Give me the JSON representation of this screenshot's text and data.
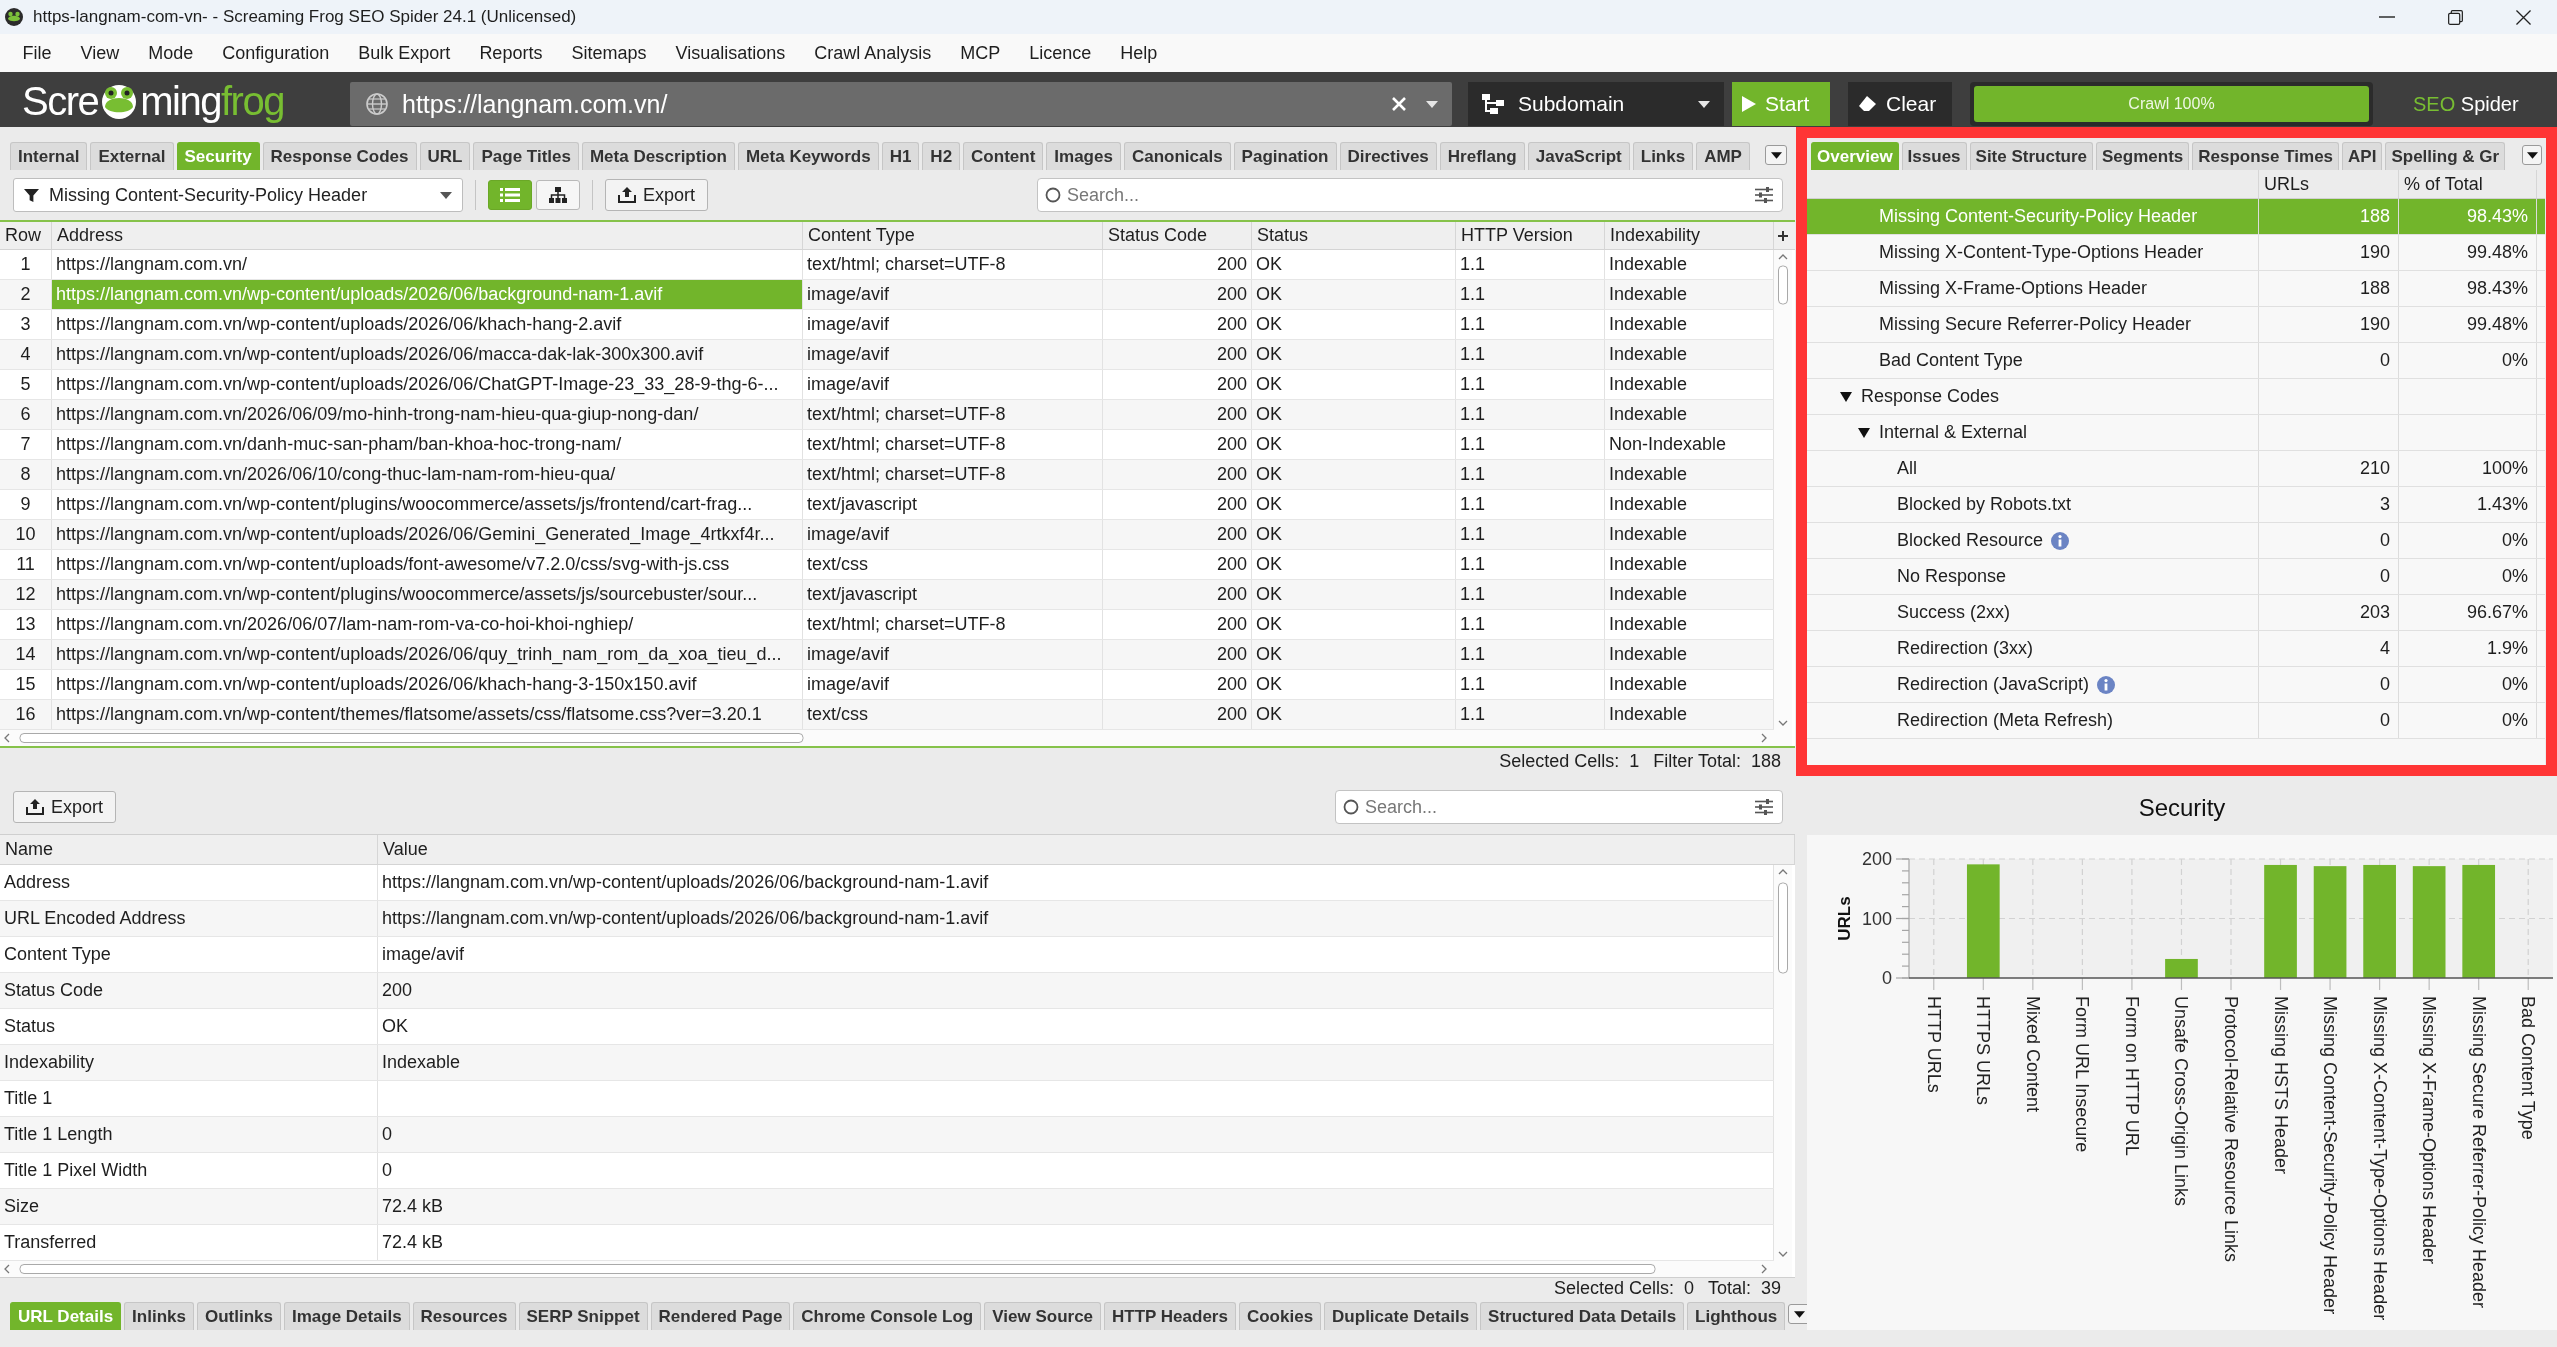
{
  "window": {
    "title": "https-langnam-com-vn- - Screaming Frog SEO Spider 24.1 (Unlicensed)"
  },
  "menu": [
    "File",
    "View",
    "Mode",
    "Configuration",
    "Bulk Export",
    "Reports",
    "Sitemaps",
    "Visualisations",
    "Crawl Analysis",
    "MCP",
    "Licence",
    "Help"
  ],
  "toolbar": {
    "logo": {
      "start": "Scre",
      "middle": "ming",
      "accent": "frog"
    },
    "url_field": {
      "value": "https://langnam.com.vn/"
    },
    "mode_dropdown": {
      "value": "Subdomain"
    },
    "start_button": "Start",
    "clear_button": "Clear",
    "crawl_progress": {
      "label": "Crawl 100%",
      "level": 1
    },
    "product_name": {
      "accent": "SEO",
      "text": "Spider"
    }
  },
  "main_tabs": [
    {
      "label": "Internal",
      "selected": false
    },
    {
      "label": "External",
      "selected": false
    },
    {
      "label": "Security",
      "selected": true
    },
    {
      "label": "Response Codes",
      "selected": false
    },
    {
      "label": "URL",
      "selected": false
    },
    {
      "label": "Page Titles",
      "selected": false
    },
    {
      "label": "Meta Description",
      "selected": false
    },
    {
      "label": "Meta Keywords",
      "selected": false
    },
    {
      "label": "H1",
      "selected": false
    },
    {
      "label": "H2",
      "selected": false
    },
    {
      "label": "Content",
      "selected": false
    },
    {
      "label": "Images",
      "selected": false
    },
    {
      "label": "Canonicals",
      "selected": false
    },
    {
      "label": "Pagination",
      "selected": false
    },
    {
      "label": "Directives",
      "selected": false
    },
    {
      "label": "Hreflang",
      "selected": false
    },
    {
      "label": "JavaScript",
      "selected": false
    },
    {
      "label": "Links",
      "selected": false
    },
    {
      "label": "AMP",
      "selected": false
    }
  ],
  "filter": {
    "dropdown": "Missing Content-Security-Policy Header",
    "views": [
      {
        "kind": "list",
        "selected": true
      },
      {
        "kind": "tree",
        "selected": false
      }
    ],
    "export_button": "Export",
    "search": {
      "placeholder": "Search..."
    }
  },
  "table": {
    "columns": [
      "Row",
      "Address",
      "Content Type",
      "Status Code",
      "Status",
      "HTTP Version",
      "Indexability"
    ],
    "rows": [
      {
        "cells": [
          "1",
          "https://langnam.com.vn/",
          "text/html; charset=UTF-8",
          "200",
          "OK",
          "1.1",
          "Indexable"
        ],
        "selected": false
      },
      {
        "cells": [
          "2",
          "https://langnam.com.vn/wp-content/uploads/2026/06/background-nam-1.avif",
          "image/avif",
          "200",
          "OK",
          "1.1",
          "Indexable"
        ],
        "selected": true
      },
      {
        "cells": [
          "3",
          "https://langnam.com.vn/wp-content/uploads/2026/06/khach-hang-2.avif",
          "image/avif",
          "200",
          "OK",
          "1.1",
          "Indexable"
        ],
        "selected": false
      },
      {
        "cells": [
          "4",
          "https://langnam.com.vn/wp-content/uploads/2026/06/macca-dak-lak-300x300.avif",
          "image/avif",
          "200",
          "OK",
          "1.1",
          "Indexable"
        ],
        "selected": false
      },
      {
        "cells": [
          "5",
          "https://langnam.com.vn/wp-content/uploads/2026/06/ChatGPT-Image-23_33_28-9-thg-6-...",
          "image/avif",
          "200",
          "OK",
          "1.1",
          "Indexable"
        ],
        "selected": false
      },
      {
        "cells": [
          "6",
          "https://langnam.com.vn/2026/06/09/mo-hinh-trong-nam-hieu-qua-giup-nong-dan/",
          "text/html; charset=UTF-8",
          "200",
          "OK",
          "1.1",
          "Indexable"
        ],
        "selected": false
      },
      {
        "cells": [
          "7",
          "https://langnam.com.vn/danh-muc-san-pham/ban-khoa-hoc-trong-nam/",
          "text/html; charset=UTF-8",
          "200",
          "OK",
          "1.1",
          "Non-Indexable"
        ],
        "selected": false
      },
      {
        "cells": [
          "8",
          "https://langnam.com.vn/2026/06/10/cong-thuc-lam-nam-rom-hieu-qua/",
          "text/html; charset=UTF-8",
          "200",
          "OK",
          "1.1",
          "Indexable"
        ],
        "selected": false
      },
      {
        "cells": [
          "9",
          "https://langnam.com.vn/wp-content/plugins/woocommerce/assets/js/frontend/cart-frag...",
          "text/javascript",
          "200",
          "OK",
          "1.1",
          "Indexable"
        ],
        "selected": false
      },
      {
        "cells": [
          "10",
          "https://langnam.com.vn/wp-content/uploads/2026/06/Gemini_Generated_Image_4rtkxf4r...",
          "image/avif",
          "200",
          "OK",
          "1.1",
          "Indexable"
        ],
        "selected": false
      },
      {
        "cells": [
          "11",
          "https://langnam.com.vn/wp-content/uploads/font-awesome/v7.2.0/css/svg-with-js.css",
          "text/css",
          "200",
          "OK",
          "1.1",
          "Indexable"
        ],
        "selected": false
      },
      {
        "cells": [
          "12",
          "https://langnam.com.vn/wp-content/plugins/woocommerce/assets/js/sourcebuster/sour...",
          "text/javascript",
          "200",
          "OK",
          "1.1",
          "Indexable"
        ],
        "selected": false
      },
      {
        "cells": [
          "13",
          "https://langnam.com.vn/2026/06/07/lam-nam-rom-va-co-hoi-khoi-nghiep/",
          "text/html; charset=UTF-8",
          "200",
          "OK",
          "1.1",
          "Indexable"
        ],
        "selected": false
      },
      {
        "cells": [
          "14",
          "https://langnam.com.vn/wp-content/uploads/2026/06/quy_trinh_nam_rom_da_xoa_tieu_d...",
          "image/avif",
          "200",
          "OK",
          "1.1",
          "Indexable"
        ],
        "selected": false
      },
      {
        "cells": [
          "15",
          "https://langnam.com.vn/wp-content/uploads/2026/06/khach-hang-3-150x150.avif",
          "image/avif",
          "200",
          "OK",
          "1.1",
          "Indexable"
        ],
        "selected": false
      },
      {
        "cells": [
          "16",
          "https://langnam.com.vn/wp-content/themes/flatsome/assets/css/flatsome.css?ver=3.20.1",
          "text/css",
          "200",
          "OK",
          "1.1",
          "Indexable"
        ],
        "selected": false
      }
    ],
    "status": [
      "Selected Cells:  1",
      "Filter Total:  188"
    ]
  },
  "details": {
    "export_button": "Export",
    "search": {
      "placeholder": "Search..."
    },
    "columns": [
      "Name",
      "Value"
    ],
    "rows": [
      {
        "name": "Address",
        "value": "https://langnam.com.vn/wp-content/uploads/2026/06/background-nam-1.avif"
      },
      {
        "name": "URL Encoded Address",
        "value": "https://langnam.com.vn/wp-content/uploads/2026/06/background-nam-1.avif"
      },
      {
        "name": "Content Type",
        "value": "image/avif"
      },
      {
        "name": "Status Code",
        "value": "200"
      },
      {
        "name": "Status",
        "value": "OK"
      },
      {
        "name": "Indexability",
        "value": "Indexable"
      },
      {
        "name": "Title 1"
      },
      {
        "name": "Title 1 Length",
        "value": "0"
      },
      {
        "name": "Title 1 Pixel Width",
        "value": "0"
      },
      {
        "name": "Size",
        "value": "72.4 kB"
      },
      {
        "name": "Transferred",
        "value": "72.4 kB"
      }
    ],
    "status": [
      "Selected Cells:  0",
      "Total:  39"
    ]
  },
  "detail_tabs": [
    {
      "label": "URL Details",
      "selected": true
    },
    {
      "label": "Inlinks",
      "selected": false
    },
    {
      "label": "Outlinks",
      "selected": false
    },
    {
      "label": "Image Details",
      "selected": false
    },
    {
      "label": "Resources",
      "selected": false
    },
    {
      "label": "SERP Snippet",
      "selected": false
    },
    {
      "label": "Rendered Page",
      "selected": false
    },
    {
      "label": "Chrome Console Log",
      "selected": false
    },
    {
      "label": "View Source",
      "selected": false
    },
    {
      "label": "HTTP Headers",
      "selected": false
    },
    {
      "label": "Cookies",
      "selected": false
    },
    {
      "label": "Duplicate Details",
      "selected": false
    },
    {
      "label": "Structured Data Details",
      "selected": false
    },
    {
      "label": "Lighthous",
      "selected": false
    }
  ],
  "overview_tabs": [
    {
      "label": "Overview",
      "selected": true
    },
    {
      "label": "Issues",
      "selected": false
    },
    {
      "label": "Site Structure",
      "selected": false
    },
    {
      "label": "Segments",
      "selected": false
    },
    {
      "label": "Response Times",
      "selected": false
    },
    {
      "label": "API",
      "selected": false
    },
    {
      "label": "Spelling & Gr",
      "selected": false
    }
  ],
  "overview": {
    "columns": [
      "URLs",
      "% of Total"
    ],
    "continued_rows": [
      {
        "label": "Missing Content-Security-Policy Header",
        "urls": "188",
        "percent": "98.43%",
        "selected": true,
        "info": false
      },
      {
        "label": "Missing X-Content-Type-Options Header",
        "urls": "190",
        "percent": "99.48%",
        "selected": false,
        "info": false
      },
      {
        "label": "Missing X-Frame-Options Header",
        "urls": "188",
        "percent": "98.43%",
        "selected": false,
        "info": false
      },
      {
        "label": "Missing Secure Referrer-Policy Header",
        "urls": "190",
        "percent": "99.48%",
        "selected": false,
        "info": false
      },
      {
        "label": "Bad Content Type",
        "urls": "0",
        "percent": "0%",
        "selected": false,
        "info": false
      }
    ],
    "tree": [
      {
        "label": "Response Codes",
        "expanded": true,
        "selected": false,
        "info": false,
        "children": [
          {
            "label": "Internal & External",
            "expanded": true,
            "selected": false,
            "info": false,
            "children": [
              {
                "label": "All",
                "urls": "210",
                "percent": "100%",
                "selected": false,
                "info": false
              },
              {
                "label": "Blocked by Robots.txt",
                "urls": "3",
                "percent": "1.43%",
                "selected": false,
                "info": false
              },
              {
                "label": "Blocked Resource",
                "urls": "0",
                "percent": "0%",
                "selected": false,
                "info": true
              },
              {
                "label": "No Response",
                "urls": "0",
                "percent": "0%",
                "selected": false,
                "info": false
              },
              {
                "label": "Success (2xx)",
                "urls": "203",
                "percent": "96.67%",
                "selected": false,
                "info": false
              },
              {
                "label": "Redirection (3xx)",
                "urls": "4",
                "percent": "1.9%",
                "selected": false,
                "info": false
              },
              {
                "label": "Redirection (JavaScript)",
                "urls": "0",
                "percent": "0%",
                "selected": false,
                "info": true
              },
              {
                "label": "Redirection (Meta Refresh)",
                "urls": "0",
                "percent": "0%",
                "selected": false,
                "info": false
              }
            ]
          }
        ]
      }
    ]
  },
  "chart": {
    "chart_data": {
      "type": "bar",
      "title": "Security",
      "ylabel": "URLs",
      "categories": [
        "HTTP URLs",
        "HTTPS URLs",
        "Mixed Content",
        "Form URL Insecure",
        "Form on HTTP URL",
        "Unsafe Cross-Origin Links",
        "Protocol-Relative Resource Links",
        "Missing HSTS Header",
        "Missing Content-Security-Policy Header",
        "Missing X-Content-Type-Options Header",
        "Missing X-Frame-Options Header",
        "Missing Secure Referrer-Policy Header",
        "Bad Content Type"
      ],
      "values": [
        0,
        191,
        0,
        0,
        0,
        32,
        0,
        190,
        188,
        190,
        188,
        190,
        0
      ],
      "ylim": [
        0,
        200
      ],
      "yticks": [
        0,
        100,
        200
      ],
      "grid": true
    }
  },
  "highlight_frame": true
}
